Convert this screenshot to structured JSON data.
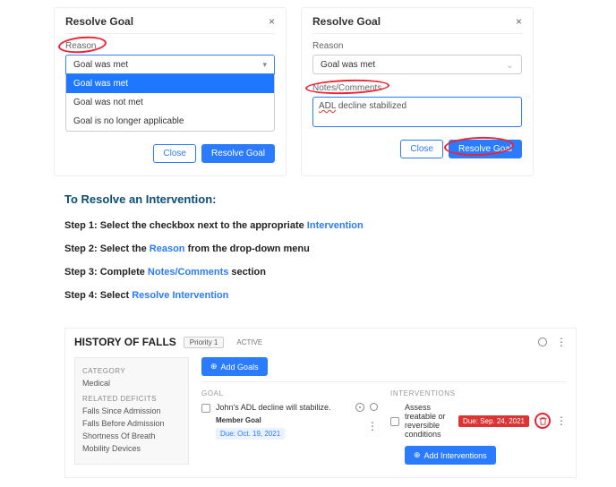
{
  "modalLeft": {
    "title": "Resolve Goal",
    "reasonLabel": "Reason",
    "selected": "Goal was met",
    "options": [
      "Goal was met",
      "Goal was not met",
      "Goal is no longer applicable"
    ],
    "closeBtn": "Close",
    "resolveBtn": "Resolve Goal"
  },
  "modalRight": {
    "title": "Resolve Goal",
    "reasonLabel": "Reason",
    "selected": "Goal was met",
    "notesLabel": "Notes/Comments",
    "notesValue": "ADL decline stabilized",
    "closeBtn": "Close",
    "resolveBtn": "Resolve Goal"
  },
  "section": {
    "title": "To Resolve an Intervention:",
    "step1a": "Step 1: Select the checkbox next to the appropriate ",
    "step1b": "Intervention",
    "step2a": "Step 2: Select the ",
    "step2b": "Reason",
    "step2c": " from the drop-down menu",
    "step3a": "Step 3: Complete ",
    "step3b": "Notes/Comments",
    "step3c": " section",
    "step4a": "Step 4: Select ",
    "step4b": "Resolve Intervention"
  },
  "panel": {
    "title": "HISTORY OF FALLS",
    "chipPriority": "Priority 1",
    "chipActive": "ACTIVE",
    "col1": {
      "catHd": "CATEGORY",
      "cat": "Medical",
      "defHd": "RELATED DEFICITS",
      "items": [
        "Falls Since Admission",
        "Falls Before Admission",
        "Shortness Of Breath",
        "Mobility Devices"
      ]
    },
    "addGoals": "Add Goals",
    "goalCard": {
      "hd": "GOAL",
      "text": "John's ADL decline will stabilize.",
      "memberGoal": "Member Goal",
      "due": "Due: Oct. 19, 2021"
    },
    "intCard": {
      "hd": "INTERVENTIONS",
      "text": "Assess treatable or reversible conditions",
      "due": "Due: Sep. 24, 2021",
      "addBtn": "Add Interventions"
    }
  }
}
